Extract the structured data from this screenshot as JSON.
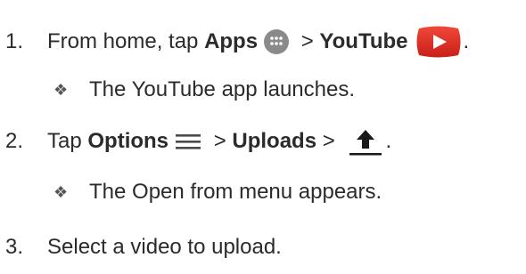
{
  "steps": [
    {
      "number": "1.",
      "prefix": "From home, tap ",
      "bold1": "Apps",
      "sep1": " > ",
      "bold2": "YouTube",
      "suffix": ".",
      "result_bullet": "❖",
      "result": "The YouTube app launches."
    },
    {
      "number": "2.",
      "prefix": "Tap ",
      "bold1": "Options",
      "sep1": " > ",
      "bold2": "Uploads",
      "sep2": " > ",
      "suffix": ".",
      "result_bullet": "❖",
      "result": "The Open from menu appears."
    },
    {
      "number": "3.",
      "text": "Select a video to upload."
    }
  ],
  "icons": {
    "apps": "apps-grid-icon",
    "youtube": "youtube-icon",
    "options": "menu-icon",
    "upload": "upload-icon"
  },
  "colors": {
    "text": "#2b2b2b",
    "youtube_red": "#e52d27",
    "apps_gray": "#8a8a8a"
  }
}
